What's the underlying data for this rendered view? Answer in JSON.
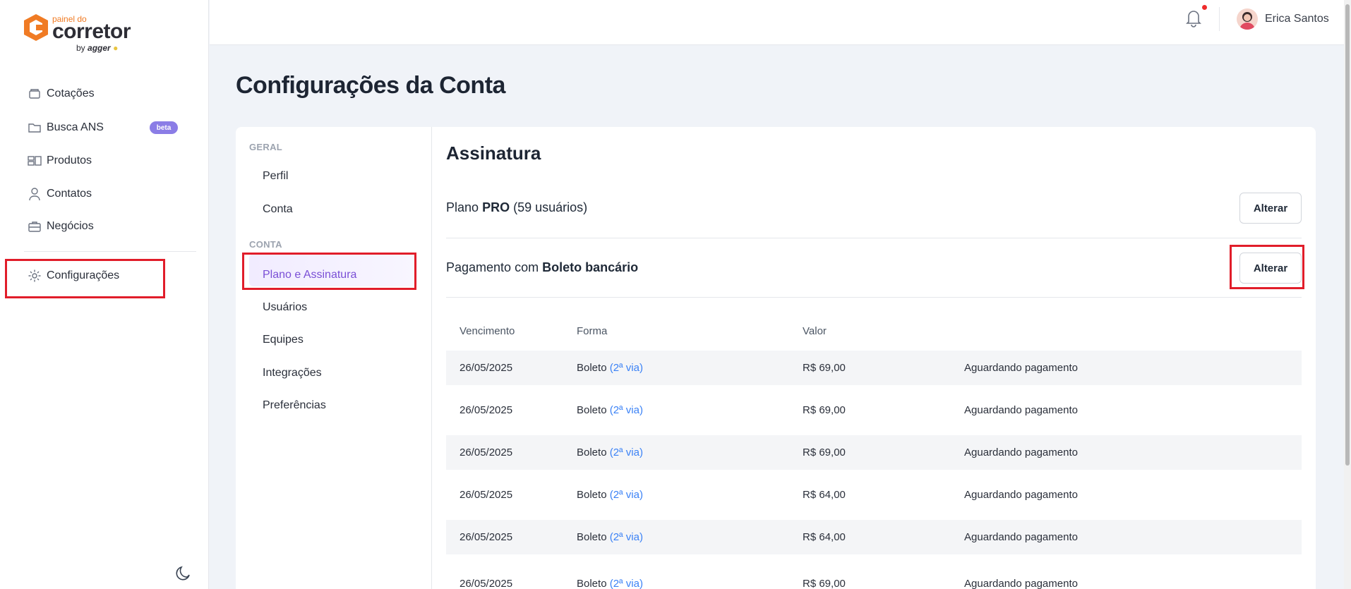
{
  "logo": {
    "small": "painel do",
    "main": "corretor",
    "by": "by",
    "brand": "agger"
  },
  "sidebar": {
    "items": [
      {
        "label": "Cotações",
        "icon": "box-icon"
      },
      {
        "label": "Busca ANS",
        "icon": "folder-icon",
        "badge": "beta"
      },
      {
        "label": "Produtos",
        "icon": "layout-icon"
      },
      {
        "label": "Contatos",
        "icon": "user-icon"
      },
      {
        "label": "Negócios",
        "icon": "briefcase-icon"
      },
      {
        "label": "Configurações",
        "icon": "gear-icon"
      }
    ],
    "theme_icon": "moon-icon"
  },
  "header": {
    "user_name": "Erica Santos",
    "notification_icon": "bell-icon"
  },
  "page": {
    "title": "Configurações da Conta"
  },
  "settings_nav": {
    "group_general": "GERAL",
    "group_account": "CONTA",
    "items": [
      "Perfil",
      "Conta",
      "Plano e Assinatura",
      "Usuários",
      "Equipes",
      "Integrações",
      "Preferências"
    ],
    "active": "Plano e Assinatura"
  },
  "subscription": {
    "title": "Assinatura",
    "plan_prefix": "Plano",
    "plan_name": "PRO",
    "plan_suffix": "(59 usuários)",
    "payment_prefix": "Pagamento com",
    "payment_method": "Boleto bancário",
    "change_label": "Alterar"
  },
  "invoices": {
    "columns": [
      "Vencimento",
      "Forma",
      "Valor"
    ],
    "link_label": "(2ª via)",
    "rows": [
      {
        "due": "26/05/2025",
        "method": "Boleto",
        "value": "R$ 69,00",
        "status": "Aguardando pagamento"
      },
      {
        "due": "26/05/2025",
        "method": "Boleto",
        "value": "R$ 69,00",
        "status": "Aguardando pagamento"
      },
      {
        "due": "26/05/2025",
        "method": "Boleto",
        "value": "R$ 69,00",
        "status": "Aguardando pagamento"
      },
      {
        "due": "26/05/2025",
        "method": "Boleto",
        "value": "R$ 64,00",
        "status": "Aguardando pagamento"
      },
      {
        "due": "26/05/2025",
        "method": "Boleto",
        "value": "R$ 64,00",
        "status": "Aguardando pagamento"
      },
      {
        "due": "26/05/2025",
        "method": "Boleto",
        "value": "R$ 69,00",
        "status": "Aguardando pagamento"
      }
    ]
  },
  "colors": {
    "accent": "#7a4fd6",
    "highlight": "#e11d2a",
    "link": "#3b82f6",
    "badge": "#8b7de6"
  }
}
